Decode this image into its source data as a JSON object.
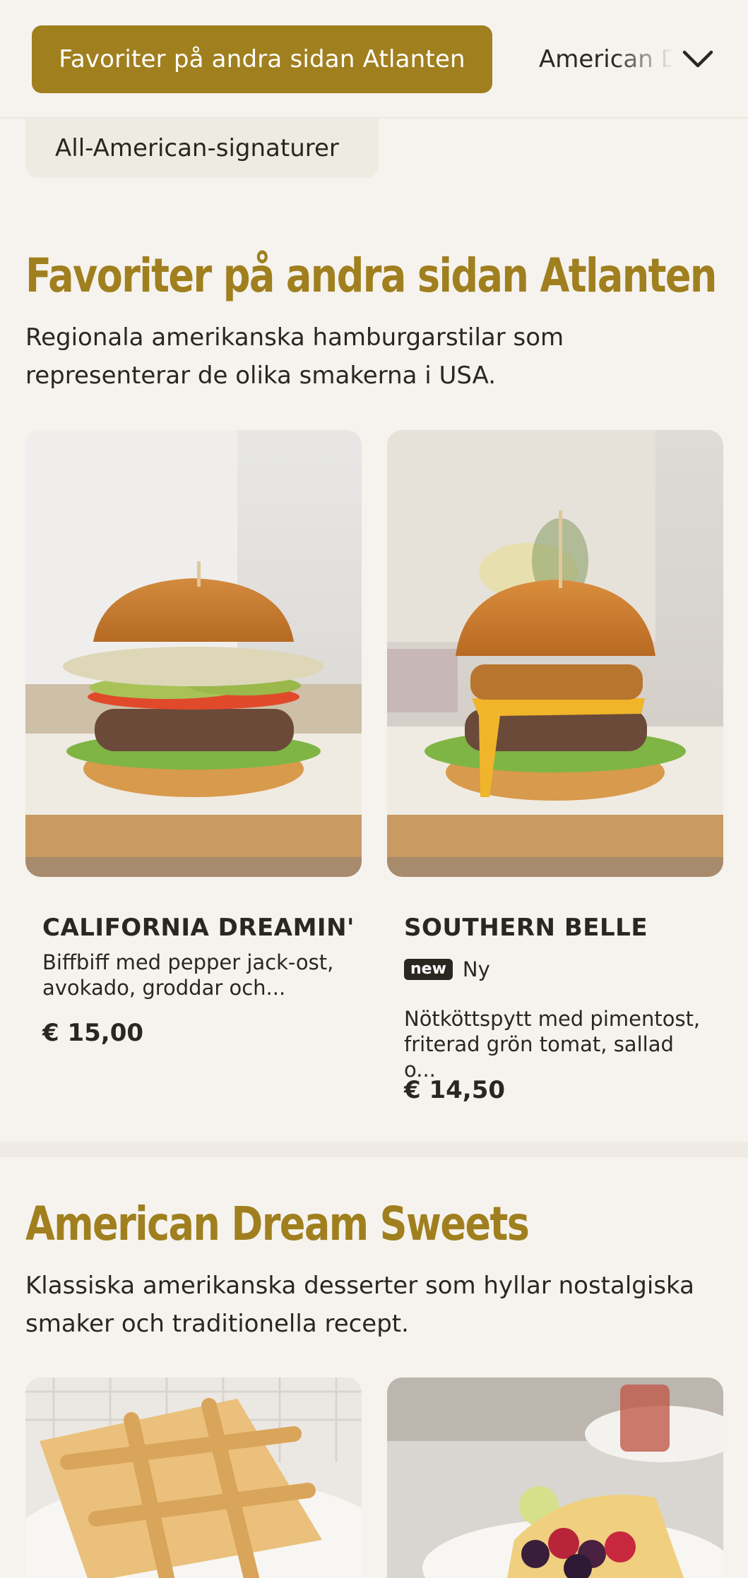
{
  "category_bar": {
    "active": "Favoriter på andra sidan Atlanten",
    "next": "American Dream Sweets",
    "previous": "All-American-signaturer",
    "chevron_icon": "chevron-down-icon"
  },
  "sections": [
    {
      "title": "Favoriter på andra sidan Atlanten",
      "description": "Regionala amerikanska hamburgarstilar som representerar de olika smakerna i USA.",
      "items": [
        {
          "name": "CALIFORNIA DREAMIN'",
          "description_line1": "Biffbiff med pepper jack-ost,",
          "description_line2": "avokado, groddar och...",
          "price": "€ 15,00"
        },
        {
          "name": "SOUTHERN BELLE",
          "badge": "new",
          "badge_label": "Ny",
          "description_line1": "Nötköttspytt med pimentost,",
          "description_line2": "friterad grön tomat, sallad o...",
          "price": "€ 14,50"
        }
      ]
    },
    {
      "title": "American Dream Sweets",
      "description": "Klassiska amerikanska desserter som hyllar nostalgiska smaker och traditionella recept."
    }
  ],
  "colors": {
    "accent": "#a07f1f",
    "background": "#f6f3ee",
    "text": "#2a2620"
  }
}
